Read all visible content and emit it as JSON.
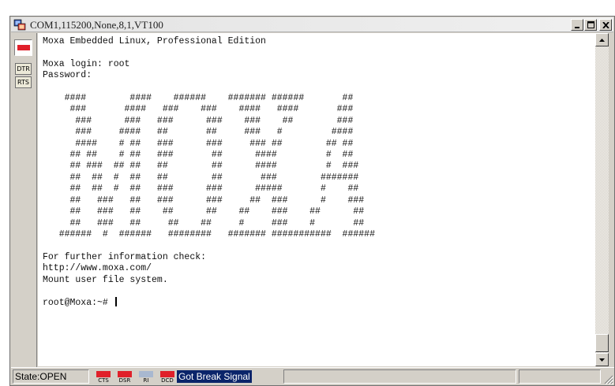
{
  "window": {
    "title": "COM1,115200,None,8,1,VT100",
    "controls": {
      "minimize": "_",
      "maximize": "□",
      "close": "×"
    }
  },
  "sidebar": {
    "connect_icon": "disconnect-red-icon",
    "dtr_label": "DTR",
    "rts_label": "RTS"
  },
  "terminal": {
    "lines": [
      "Moxa Embedded Linux, Professional Edition",
      "",
      "Moxa login: root",
      "Password:",
      "",
      "    ####        ####    ######    ####### ######       ##",
      "     ###       ####   ###    ###    ####   ####       ###",
      "      ###      ###   ###      ###    ###    ##        ###",
      "      ###     ####   ##       ##     ###   #         ####",
      "      ####    # ##   ###      ###     ### ##        ## ##",
      "     ## ##    # ##   ###       ##      ####         #  ##",
      "     ## ###  ## ##   ##        ##      ####         #  ###",
      "     ##  ##  #  ##   ##        ##       ###        #######",
      "     ##  ##  #  ##   ###      ###      #####       #    ##",
      "     ##   ###   ##   ###      ###     ##  ###      #    ###",
      "     ##   ###   ##    ##      ##    ##    ###    ##      ##",
      "     ##   ###   ##     ##    ##     #     ###    #       ##",
      "   ######  #  ######   ########   ####### ###########  ######",
      "",
      "For further information check:",
      "http://www.moxa.com/",
      "Mount user file system.",
      "",
      "root@Moxa:~#"
    ]
  },
  "statusbar": {
    "state": "State:OPEN",
    "lamps": [
      {
        "label": "CTS",
        "color": "#e0202a"
      },
      {
        "label": "DSR",
        "color": "#e0202a"
      },
      {
        "label": "RI",
        "color": "#a8b8d0"
      },
      {
        "label": "DCD",
        "color": "#e0202a"
      }
    ],
    "signal_message": "Got Break Signal"
  }
}
